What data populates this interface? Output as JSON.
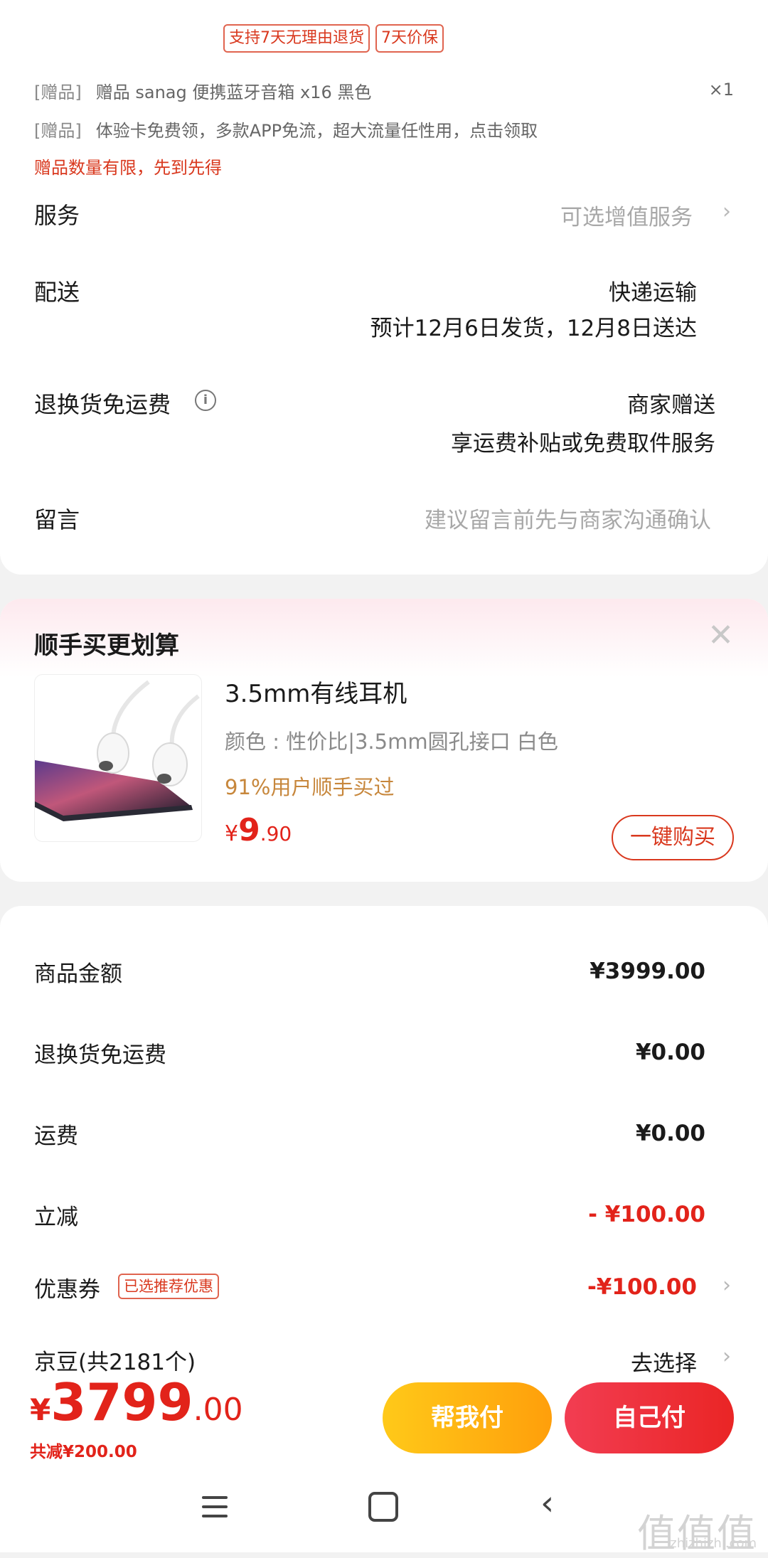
{
  "tags": {
    "return_policy": "支持7天无理由退货",
    "price_protect": "7天价保"
  },
  "gifts": [
    {
      "bracket": "[赠品]",
      "text": "赠品 sanag 便携蓝牙音箱 x16 黑色",
      "qty": "×1"
    },
    {
      "bracket": "[赠品]",
      "text": "体验卡免费领，多款APP免流，超大流量任性用，点击领取"
    }
  ],
  "gift_warning": "赠品数量有限，先到先得",
  "service": {
    "label": "服务",
    "value": "可选增值服务"
  },
  "delivery": {
    "label": "配送",
    "method": "快递运输",
    "estimate": "预计12月6日发货，12月8日送达"
  },
  "return_shipping": {
    "label": "退换货免运费",
    "value": "商家赠送",
    "desc": "享运费补贴或免费取件服务"
  },
  "message": {
    "label": "留言",
    "placeholder": "建议留言前先与商家沟通确认"
  },
  "upsell": {
    "title": "顺手买更划算",
    "product_title": "3.5mm有线耳机",
    "spec": "颜色 : 性价比|3.5mm圆孔接口 白色",
    "popularity": "91%用户顺手买过",
    "price_symbol": "¥",
    "price_int": "9",
    "price_dec": ".90",
    "buy_label": "一键购买"
  },
  "summary": [
    {
      "label": "商品金额",
      "value": "¥3999.00",
      "red": false
    },
    {
      "label": "退换货免运费",
      "value": "¥0.00",
      "red": false
    },
    {
      "label": "运费",
      "value": "¥0.00",
      "red": false
    },
    {
      "label": "立减",
      "value": "- ¥100.00",
      "red": true
    },
    {
      "label": "优惠券",
      "value": "-¥100.00",
      "red": true,
      "badge": "已选推荐优惠"
    },
    {
      "label": "京豆(共2181个)",
      "value": "去选择",
      "red": false
    }
  ],
  "total": {
    "symbol": "¥",
    "int": "3799",
    "dec": ".00",
    "saved": "共减¥200.00"
  },
  "buttons": {
    "help_pay": "帮我付",
    "self_pay": "自己付"
  },
  "watermark": {
    "main": "值值值",
    "sub": "zhizhizhi.com"
  },
  "colors": {
    "accent_red": "#e2231a",
    "orange": "#ff9f0b",
    "yellow": "#ffc919",
    "gold_text": "#c7873c"
  },
  "icons": [
    "info-icon",
    "chevron-right-icon",
    "close-icon",
    "menu-icon",
    "home-icon",
    "back-icon"
  ]
}
